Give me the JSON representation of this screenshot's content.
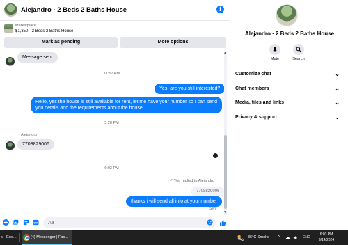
{
  "header": {
    "title": "Alejandro · 2 Beds 2 Baths House"
  },
  "marketplace": {
    "label": "Marketplace",
    "listing": "$1,350 - 2 Beds 2 Baths House",
    "pending_label": "Mark as pending",
    "more_label": "More options"
  },
  "messages": {
    "m1": "Message sent",
    "t1": "11:57 AM",
    "m2": "Yes, are you still interested?",
    "m3_line1": "Hello, yes the house is still available for rent, let me have your number so I can send",
    "m3_line2": "you details and the requirements about the house",
    "t2": "5:20 PM",
    "sender": "Alejandro",
    "m4": "7708829006",
    "t3": "6:03 PM",
    "reply_note": "You replied to Alejandro",
    "quoted": "7708829006",
    "m5": "thanks i will send all info at your number",
    "status": "Sent"
  },
  "composer": {
    "placeholder": "Aa"
  },
  "details": {
    "name": "Alejandro · 2 Beds 2 Baths House",
    "mute_label": "Mute",
    "search_label": "Search",
    "menu": [
      "Customize chat",
      "Chat members",
      "Media, files and links",
      "Privacy & support"
    ]
  },
  "taskbar": {
    "left_app": "s - Goo...",
    "messenger_app": "(4) Messenger | Fac...",
    "weather": "36°C  Smoke",
    "lang": "ENG",
    "time": "6:03 PM",
    "date": "9/14/2024"
  },
  "colors": {
    "accent": "#0a7cff",
    "bubble_in": "#e4e6eb",
    "taskbar": "#202020"
  }
}
